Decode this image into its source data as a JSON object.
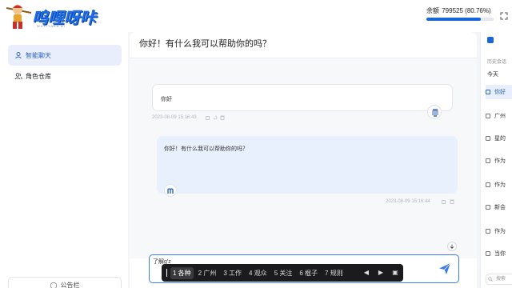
{
  "header": {
    "brand_text": "呜哩呀咔",
    "brand_sub": "WULIYAKA AI",
    "balance_label": "余额",
    "balance_value": "799525 (80.76%)",
    "balance_fraction": 0.8076,
    "accent_color": "#1a66d9"
  },
  "sidebar": {
    "items": [
      {
        "label": "智能聊天",
        "icon": "chat-user-icon",
        "active": true
      },
      {
        "label": "角色仓库",
        "icon": "users-icon",
        "active": false
      }
    ],
    "bulletin_label": "公告栏"
  },
  "chat": {
    "title": "你好！有什么我可以帮助你的吗？",
    "messages": [
      {
        "role": "user",
        "text": "你好",
        "timestamp": "2023-08-09 15:16:43"
      },
      {
        "role": "assistant",
        "text": "你好！有什么我可以帮助你的吗？",
        "timestamp": "2023-08-09 15:16:44"
      }
    ],
    "input_value": "了解g'z"
  },
  "ime": {
    "candidates": [
      "1 各种",
      "2 广州",
      "3 工作",
      "4 观众",
      "5 关注",
      "6 棍子",
      "7 规则"
    ]
  },
  "history": {
    "label": "历史会话",
    "day": "今天",
    "items": [
      {
        "label": "你好",
        "active": true
      },
      {
        "label": "广州",
        "active": false
      },
      {
        "label": "星的",
        "active": false
      },
      {
        "label": "作为",
        "active": false
      },
      {
        "label": "作为",
        "active": false
      },
      {
        "label": "新会",
        "active": false
      },
      {
        "label": "作为",
        "active": false
      },
      {
        "label": "当你",
        "active": false
      }
    ],
    "search_placeholder": "搜索"
  }
}
